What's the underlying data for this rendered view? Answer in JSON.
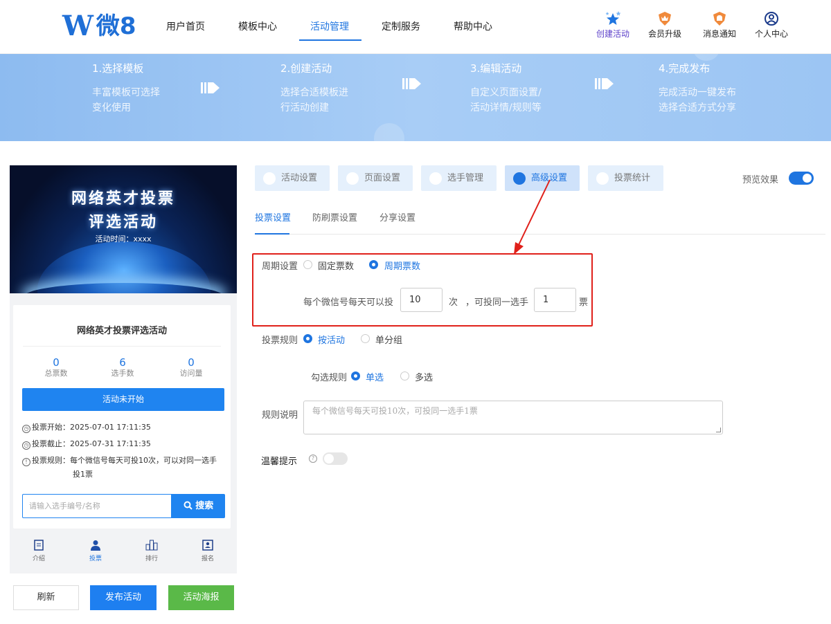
{
  "logo": {
    "text": "微8",
    "mark": "W"
  },
  "nav": {
    "items": [
      "用户首页",
      "模板中心",
      "活动管理",
      "定制服务",
      "帮助中心"
    ],
    "active": "活动管理"
  },
  "top_actions": [
    {
      "label": "创建活动",
      "icon": "star-cluster-icon"
    },
    {
      "label": "会员升级",
      "icon": "crown-shield-icon"
    },
    {
      "label": "消息通知",
      "icon": "bell-shield-icon"
    },
    {
      "label": "个人中心",
      "icon": "user-circle-icon"
    }
  ],
  "steps": [
    {
      "title": "1.选择模板",
      "line1": "丰富模板可选择",
      "line2": "变化使用"
    },
    {
      "title": "2.创建活动",
      "line1": "选择合适模板进",
      "line2": "行活动创建"
    },
    {
      "title": "3.编辑活动",
      "line1": "自定义页面设置/",
      "line2": "活动详情/规则等"
    },
    {
      "title": "4.完成发布",
      "line1": "完成活动一键发布",
      "line2": "选择合适方式分享"
    }
  ],
  "preview": {
    "hero_title_1": "网络英才投票",
    "hero_title_2": "评选活动",
    "hero_time": "活动时间：xxxx",
    "card_title": "网络英才投票评选活动",
    "stats": [
      {
        "value": "0",
        "label": "总票数"
      },
      {
        "value": "6",
        "label": "选手数"
      },
      {
        "value": "0",
        "label": "访问量"
      }
    ],
    "status_button": "活动未开始",
    "vote_start": "投票开始：2025-07-01 17:11:35",
    "vote_end": "投票截止：2025-07-31 17:11:35",
    "vote_rule_1": "投票规则：每个微信号每天可投10次，可以对同一选手",
    "vote_rule_2": "投1票",
    "search_placeholder": "请输入选手编号/名称",
    "search_button": "搜索",
    "tabbar": [
      "介绍",
      "投票",
      "排行",
      "报名"
    ],
    "tabbar_active": "投票"
  },
  "bottom_buttons": {
    "refresh": "刷新",
    "publish": "发布活动",
    "poster": "活动海报"
  },
  "settings": {
    "tabs": [
      "活动设置",
      "页面设置",
      "选手管理",
      "高级设置",
      "投票统计"
    ],
    "active_tab": "高级设置",
    "preview_label": "预览效果",
    "preview_on": true,
    "subtabs": [
      "投票设置",
      "防刷票设置",
      "分享设置"
    ],
    "active_subtab": "投票设置",
    "period_label": "周期设置",
    "period_options": [
      "固定票数",
      "周期票数"
    ],
    "period_selected": "周期票数",
    "per_day_prefix": "每个微信号每天可以投",
    "per_day_value": "10",
    "per_day_unit": "次",
    "same_player_prefix": "，可投同一选手",
    "same_player_value": "1",
    "same_player_unit": "票",
    "rule_label": "投票规则",
    "rule_options": [
      "按活动",
      "单分组"
    ],
    "rule_selected": "按活动",
    "check_label": "勾选规则",
    "check_options": [
      "单选",
      "多选"
    ],
    "check_selected": "单选",
    "desc_label": "规则说明",
    "desc_placeholder": "每个微信号每天可投10次，可投同一选手1票",
    "tip_label": "温馨提示",
    "tip_help": "?",
    "tip_on": false
  },
  "colors": {
    "accent": "#1f75e0",
    "highlight_box": "#e0201a",
    "poster_green": "#5ab948"
  }
}
